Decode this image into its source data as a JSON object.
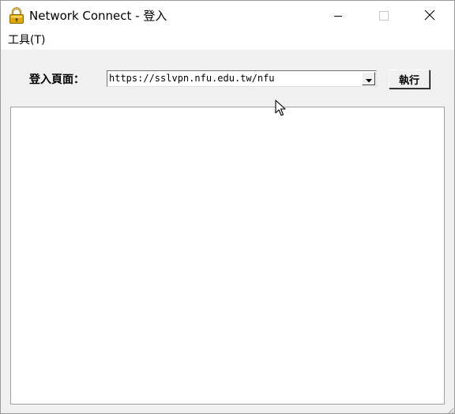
{
  "window": {
    "title": "Network Connect - 登入",
    "icons": {
      "app": "padlock-icon",
      "minimize": "minimize-icon",
      "maximize": "maximize-icon",
      "close": "close-icon"
    }
  },
  "menu": {
    "tools_label": "工具(T)"
  },
  "login": {
    "label": "登入頁面：",
    "url_value": "https://sslvpn.nfu.edu.tw/nfu",
    "run_label": "執行"
  },
  "colors": {
    "frame_bg": "#f0f0f0",
    "titlebar_bg": "#ffffff",
    "padlock_gold": "#e0a800"
  }
}
